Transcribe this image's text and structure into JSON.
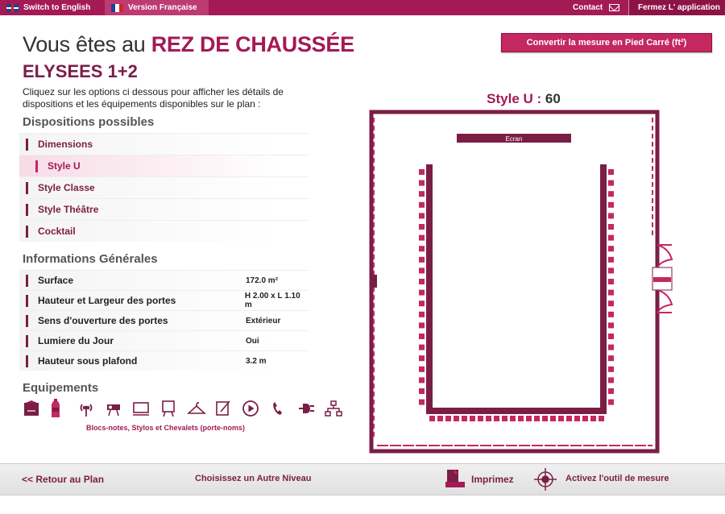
{
  "topbar": {
    "switch_english": "Switch to English",
    "version_francaise": "Version Française",
    "contact": "Contact",
    "close_app": "Fermez L' application"
  },
  "header": {
    "prefix": "Vous êtes au ",
    "level": "REZ DE CHAUSSÉE",
    "room": "ELYSEES 1+2",
    "instructions": "Cliquez sur les options ci dessous pour afficher les détails de dispositions et les équipements disponibles sur le plan :",
    "convert_button": "Convertir la mesure en Pied Carré (ft²)"
  },
  "dispositions": {
    "title": "Dispositions possibles",
    "items": [
      {
        "label": "Dimensions"
      },
      {
        "label": "Style U"
      },
      {
        "label": "Style Classe"
      },
      {
        "label": "Style Théâtre"
      },
      {
        "label": "Cocktail"
      }
    ],
    "selected": "Style U"
  },
  "informations": {
    "title": "Informations Générales",
    "rows": [
      {
        "key": "Surface",
        "value": "172.0 m²"
      },
      {
        "key": "Hauteur et Largeur des portes",
        "value": "H 2.00 x L 1.10 m"
      },
      {
        "key": "Sens d'ouverture des portes",
        "value": "Extérieur"
      },
      {
        "key": "Lumiere du Jour",
        "value": "Oui"
      },
      {
        "key": "Hauteur sous plafond",
        "value": "3.2 m"
      }
    ]
  },
  "equipements": {
    "title": "Equipements",
    "icons": [
      "notepad-icon",
      "water-bottle-icon",
      "wifi-antenna-icon",
      "projector-icon",
      "screen-icon",
      "flipchart-icon",
      "coat-hanger-icon",
      "paperboard-icon",
      "video-play-icon",
      "telephone-icon",
      "power-plug-icon",
      "network-icon"
    ],
    "caption": "Blocs-notes, Stylos et Chevalets (porte-noms)"
  },
  "plan": {
    "style_label": "Style U : ",
    "capacity": "60",
    "screen_label": "Ecran",
    "colors": {
      "accent": "#a31a55",
      "dark": "#7a1e46",
      "seat": "#c3285f"
    }
  },
  "bottombar": {
    "back": "<< Retour au Plan",
    "choose_level": "Choisissez un Autre Niveau",
    "print": "Imprimez",
    "measure": "Activez l'outil de mesure"
  }
}
